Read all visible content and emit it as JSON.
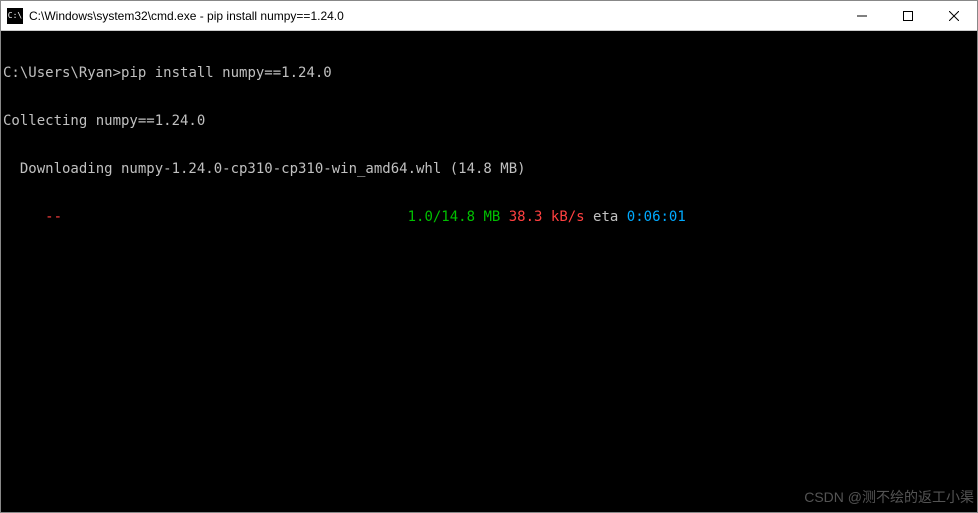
{
  "titlebar": {
    "icon_label": "C:\\",
    "title": "C:\\Windows\\system32\\cmd.exe - pip  install numpy==1.24.0"
  },
  "terminal": {
    "prompt": "C:\\Users\\Ryan>",
    "command": "pip install numpy==1.24.0",
    "line2": "Collecting numpy==1.24.0",
    "line3": "  Downloading numpy-1.24.0-cp310-cp310-win_amd64.whl (14.8 MB)",
    "progress_bar": "     --",
    "progress_mb": "1.0/14.8 MB",
    "progress_speed": "38.3 kB/s",
    "progress_eta_label": "eta",
    "progress_eta": "0:06:01"
  },
  "watermark": "CSDN @测不绘的返工小渠"
}
